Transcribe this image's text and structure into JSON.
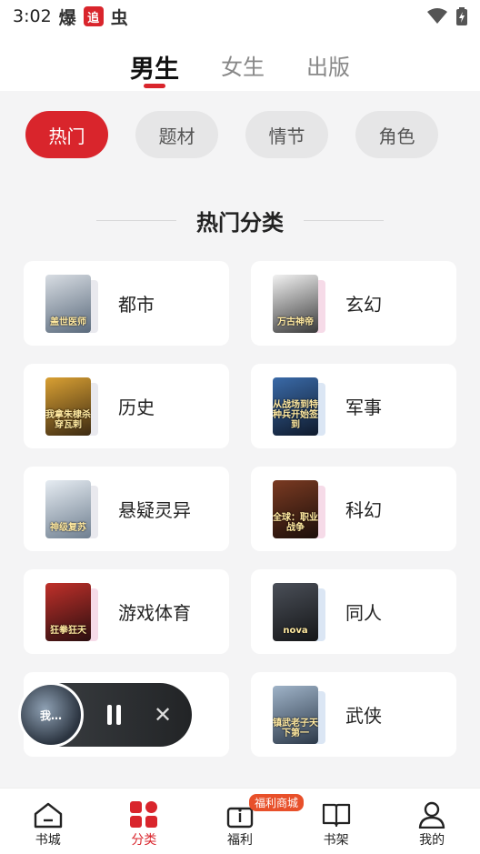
{
  "status": {
    "time": "3:02",
    "icon1": "爆",
    "icon2": "追",
    "icon3": "虫"
  },
  "topnav": {
    "tabs": [
      "男生",
      "女生",
      "出版"
    ]
  },
  "chips": [
    "热门",
    "题材",
    "情节",
    "角色"
  ],
  "section": {
    "title": "热门分类"
  },
  "categories": [
    {
      "name": "都市",
      "cover": "盖世医师",
      "c1": "#d8dde3",
      "c2": "#5a6a7c",
      "shadow": "#e9e9ee"
    },
    {
      "name": "玄幻",
      "cover": "万古神帝",
      "c1": "#f2f2f2",
      "c2": "#3a3a3a",
      "shadow": "#f6dbe8"
    },
    {
      "name": "历史",
      "cover": "我拿朱棣杀穿瓦剌",
      "c1": "#d9a033",
      "c2": "#3c2a12",
      "shadow": "#e9e9ee"
    },
    {
      "name": "军事",
      "cover": "从战场到特种兵开始签到",
      "c1": "#3a6aa8",
      "c2": "#0f1a2c",
      "shadow": "#dbe6f4"
    },
    {
      "name": "悬疑灵异",
      "cover": "神级复苏",
      "c1": "#e6ecf2",
      "c2": "#6f7f90",
      "shadow": "#e9e9ee"
    },
    {
      "name": "科幻",
      "cover": "全球：职业战争",
      "c1": "#7a3a22",
      "c2": "#1c0f0a",
      "shadow": "#f6dbe8"
    },
    {
      "name": "游戏体育",
      "cover": "狂拳狂天",
      "c1": "#c0302a",
      "c2": "#2b0f10",
      "shadow": "#f6dbe8"
    },
    {
      "name": "同人",
      "cover": "nova",
      "c1": "#4a4f58",
      "c2": "#151618",
      "shadow": "#dbe6f4"
    },
    {
      "name": "",
      "cover": "",
      "c1": "#ffffff",
      "c2": "#ffffff",
      "shadow": "#ffffff"
    },
    {
      "name": "武侠",
      "cover": "镇武老子天下第一",
      "c1": "#9fb3c8",
      "c2": "#2d3a4a",
      "shadow": "#dbe6f4"
    }
  ],
  "player": {
    "cover": "我…"
  },
  "bottomnav": {
    "items": [
      "书城",
      "分类",
      "福利",
      "书架",
      "我的"
    ],
    "welfare_tag": "福利商城"
  }
}
